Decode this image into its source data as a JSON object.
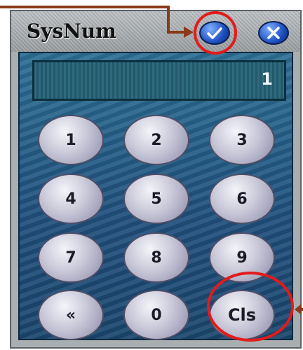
{
  "window": {
    "title": "SysNum",
    "ok_icon": "checkmark-icon",
    "cancel_icon": "x-icon"
  },
  "display": {
    "value": "1"
  },
  "keypad": {
    "keys": [
      "1",
      "2",
      "3",
      "4",
      "5",
      "6",
      "7",
      "8",
      "9",
      "«",
      "0",
      "Cls"
    ]
  },
  "colors": {
    "annotation_circle": "#e21b1b",
    "annotation_arrow": "#8a3a1a",
    "panel": "#1f4f7c",
    "title_button": "#1d4fc0"
  }
}
